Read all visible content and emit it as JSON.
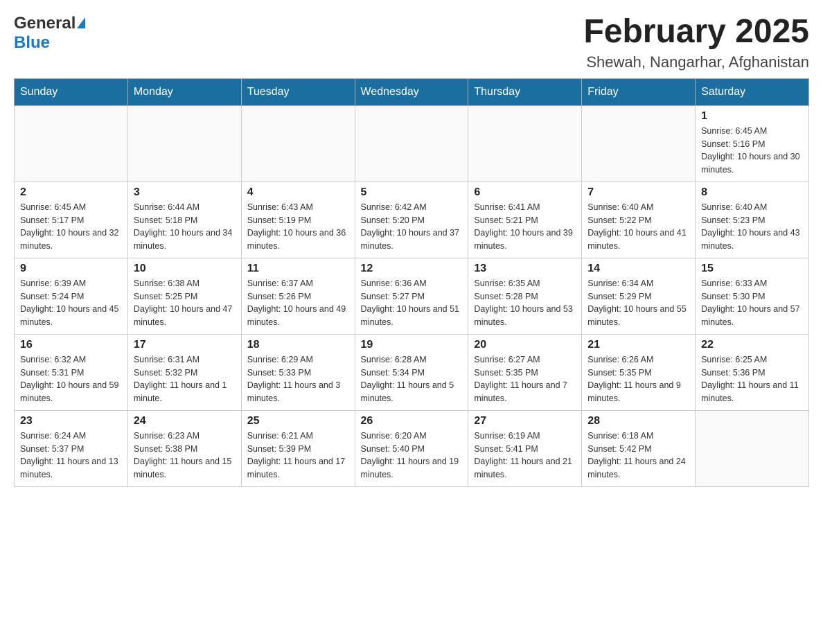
{
  "header": {
    "title": "February 2025",
    "subtitle": "Shewah, Nangarhar, Afghanistan",
    "logo_general": "General",
    "logo_blue": "Blue"
  },
  "weekdays": [
    "Sunday",
    "Monday",
    "Tuesday",
    "Wednesday",
    "Thursday",
    "Friday",
    "Saturday"
  ],
  "weeks": [
    [
      {
        "day": "",
        "sunrise": "",
        "sunset": "",
        "daylight": ""
      },
      {
        "day": "",
        "sunrise": "",
        "sunset": "",
        "daylight": ""
      },
      {
        "day": "",
        "sunrise": "",
        "sunset": "",
        "daylight": ""
      },
      {
        "day": "",
        "sunrise": "",
        "sunset": "",
        "daylight": ""
      },
      {
        "day": "",
        "sunrise": "",
        "sunset": "",
        "daylight": ""
      },
      {
        "day": "",
        "sunrise": "",
        "sunset": "",
        "daylight": ""
      },
      {
        "day": "1",
        "sunrise": "Sunrise: 6:45 AM",
        "sunset": "Sunset: 5:16 PM",
        "daylight": "Daylight: 10 hours and 30 minutes."
      }
    ],
    [
      {
        "day": "2",
        "sunrise": "Sunrise: 6:45 AM",
        "sunset": "Sunset: 5:17 PM",
        "daylight": "Daylight: 10 hours and 32 minutes."
      },
      {
        "day": "3",
        "sunrise": "Sunrise: 6:44 AM",
        "sunset": "Sunset: 5:18 PM",
        "daylight": "Daylight: 10 hours and 34 minutes."
      },
      {
        "day": "4",
        "sunrise": "Sunrise: 6:43 AM",
        "sunset": "Sunset: 5:19 PM",
        "daylight": "Daylight: 10 hours and 36 minutes."
      },
      {
        "day": "5",
        "sunrise": "Sunrise: 6:42 AM",
        "sunset": "Sunset: 5:20 PM",
        "daylight": "Daylight: 10 hours and 37 minutes."
      },
      {
        "day": "6",
        "sunrise": "Sunrise: 6:41 AM",
        "sunset": "Sunset: 5:21 PM",
        "daylight": "Daylight: 10 hours and 39 minutes."
      },
      {
        "day": "7",
        "sunrise": "Sunrise: 6:40 AM",
        "sunset": "Sunset: 5:22 PM",
        "daylight": "Daylight: 10 hours and 41 minutes."
      },
      {
        "day": "8",
        "sunrise": "Sunrise: 6:40 AM",
        "sunset": "Sunset: 5:23 PM",
        "daylight": "Daylight: 10 hours and 43 minutes."
      }
    ],
    [
      {
        "day": "9",
        "sunrise": "Sunrise: 6:39 AM",
        "sunset": "Sunset: 5:24 PM",
        "daylight": "Daylight: 10 hours and 45 minutes."
      },
      {
        "day": "10",
        "sunrise": "Sunrise: 6:38 AM",
        "sunset": "Sunset: 5:25 PM",
        "daylight": "Daylight: 10 hours and 47 minutes."
      },
      {
        "day": "11",
        "sunrise": "Sunrise: 6:37 AM",
        "sunset": "Sunset: 5:26 PM",
        "daylight": "Daylight: 10 hours and 49 minutes."
      },
      {
        "day": "12",
        "sunrise": "Sunrise: 6:36 AM",
        "sunset": "Sunset: 5:27 PM",
        "daylight": "Daylight: 10 hours and 51 minutes."
      },
      {
        "day": "13",
        "sunrise": "Sunrise: 6:35 AM",
        "sunset": "Sunset: 5:28 PM",
        "daylight": "Daylight: 10 hours and 53 minutes."
      },
      {
        "day": "14",
        "sunrise": "Sunrise: 6:34 AM",
        "sunset": "Sunset: 5:29 PM",
        "daylight": "Daylight: 10 hours and 55 minutes."
      },
      {
        "day": "15",
        "sunrise": "Sunrise: 6:33 AM",
        "sunset": "Sunset: 5:30 PM",
        "daylight": "Daylight: 10 hours and 57 minutes."
      }
    ],
    [
      {
        "day": "16",
        "sunrise": "Sunrise: 6:32 AM",
        "sunset": "Sunset: 5:31 PM",
        "daylight": "Daylight: 10 hours and 59 minutes."
      },
      {
        "day": "17",
        "sunrise": "Sunrise: 6:31 AM",
        "sunset": "Sunset: 5:32 PM",
        "daylight": "Daylight: 11 hours and 1 minute."
      },
      {
        "day": "18",
        "sunrise": "Sunrise: 6:29 AM",
        "sunset": "Sunset: 5:33 PM",
        "daylight": "Daylight: 11 hours and 3 minutes."
      },
      {
        "day": "19",
        "sunrise": "Sunrise: 6:28 AM",
        "sunset": "Sunset: 5:34 PM",
        "daylight": "Daylight: 11 hours and 5 minutes."
      },
      {
        "day": "20",
        "sunrise": "Sunrise: 6:27 AM",
        "sunset": "Sunset: 5:35 PM",
        "daylight": "Daylight: 11 hours and 7 minutes."
      },
      {
        "day": "21",
        "sunrise": "Sunrise: 6:26 AM",
        "sunset": "Sunset: 5:35 PM",
        "daylight": "Daylight: 11 hours and 9 minutes."
      },
      {
        "day": "22",
        "sunrise": "Sunrise: 6:25 AM",
        "sunset": "Sunset: 5:36 PM",
        "daylight": "Daylight: 11 hours and 11 minutes."
      }
    ],
    [
      {
        "day": "23",
        "sunrise": "Sunrise: 6:24 AM",
        "sunset": "Sunset: 5:37 PM",
        "daylight": "Daylight: 11 hours and 13 minutes."
      },
      {
        "day": "24",
        "sunrise": "Sunrise: 6:23 AM",
        "sunset": "Sunset: 5:38 PM",
        "daylight": "Daylight: 11 hours and 15 minutes."
      },
      {
        "day": "25",
        "sunrise": "Sunrise: 6:21 AM",
        "sunset": "Sunset: 5:39 PM",
        "daylight": "Daylight: 11 hours and 17 minutes."
      },
      {
        "day": "26",
        "sunrise": "Sunrise: 6:20 AM",
        "sunset": "Sunset: 5:40 PM",
        "daylight": "Daylight: 11 hours and 19 minutes."
      },
      {
        "day": "27",
        "sunrise": "Sunrise: 6:19 AM",
        "sunset": "Sunset: 5:41 PM",
        "daylight": "Daylight: 11 hours and 21 minutes."
      },
      {
        "day": "28",
        "sunrise": "Sunrise: 6:18 AM",
        "sunset": "Sunset: 5:42 PM",
        "daylight": "Daylight: 11 hours and 24 minutes."
      },
      {
        "day": "",
        "sunrise": "",
        "sunset": "",
        "daylight": ""
      }
    ]
  ]
}
